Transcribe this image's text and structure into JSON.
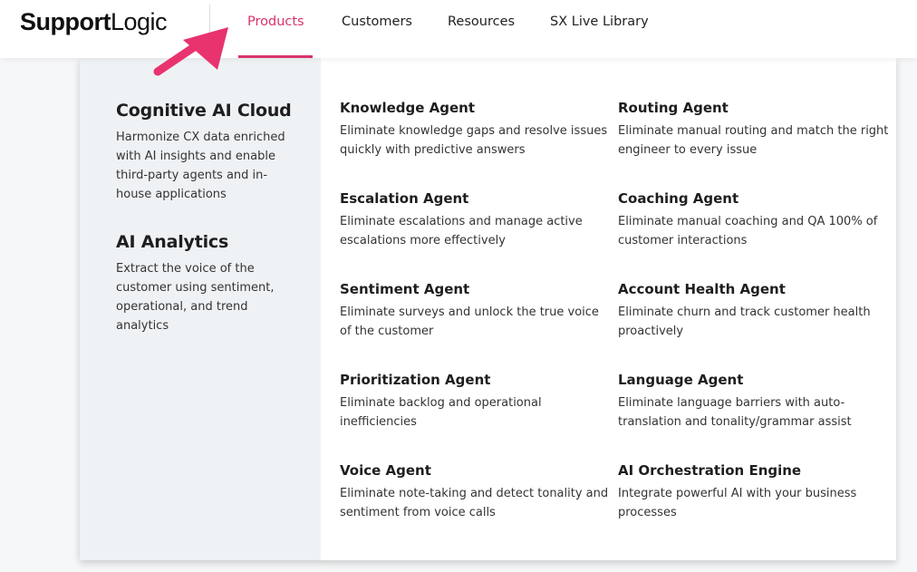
{
  "logo": {
    "part1": "Support",
    "part2": "Logic"
  },
  "nav": {
    "items": [
      {
        "label": "Products",
        "active": true
      },
      {
        "label": "Customers"
      },
      {
        "label": "Resources"
      },
      {
        "label": "SX Live Library"
      }
    ]
  },
  "colors": {
    "accent": "#d9326c",
    "panel_bg": "#eff2f5"
  },
  "annotation": {
    "icon": "arrow-icon",
    "color": "#e8336f"
  },
  "dropdown": {
    "categories": [
      {
        "title": "Cognitive AI Cloud",
        "description": "Harmonize CX data enriched with AI insights and enable third-party agents and in-house applications"
      },
      {
        "title": "AI Analytics",
        "description": "Extract the voice of the customer using sentiment, operational, and trend analytics"
      }
    ],
    "agents": [
      {
        "title": "Knowledge Agent",
        "description": "Eliminate knowledge gaps and resolve issues quickly with predictive answers"
      },
      {
        "title": "Routing Agent",
        "description": "Eliminate manual routing and match the right engineer to every issue"
      },
      {
        "title": "Escalation Agent",
        "description": "Eliminate escalations and manage active escalations more effectively"
      },
      {
        "title": "Coaching Agent",
        "description": "Eliminate manual coaching and QA 100% of customer interactions"
      },
      {
        "title": "Sentiment Agent",
        "description": "Eliminate surveys and unlock the true voice of the customer"
      },
      {
        "title": "Account Health Agent",
        "description": "Eliminate churn and track customer health proactively"
      },
      {
        "title": "Prioritization Agent",
        "description": "Eliminate backlog and operational inefficiencies"
      },
      {
        "title": "Language Agent",
        "description": "Eliminate language barriers with auto-translation and tonality/grammar assist"
      },
      {
        "title": "Voice Agent",
        "description": "Eliminate note-taking and detect tonality and sentiment from voice calls"
      },
      {
        "title": "AI Orchestration Engine",
        "description": "Integrate powerful AI with your business processes"
      }
    ]
  }
}
